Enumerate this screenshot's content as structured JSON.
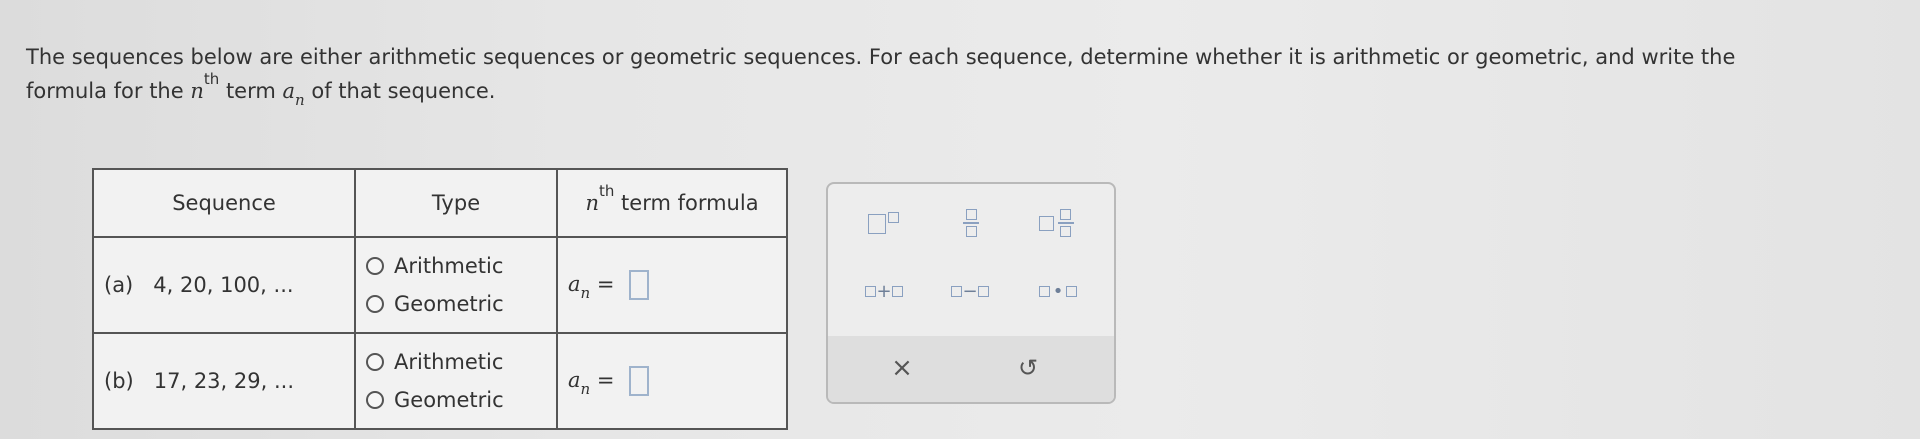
{
  "prompt": {
    "text_1": "The sequences below are either arithmetic sequences or geometric sequences. For each sequence, determine whether it is arithmetic or geometric, and write the",
    "text_2a": "formula for the ",
    "n": "n",
    "th": "th",
    "text_2b": " term ",
    "a": "a",
    "text_2c": " of that sequence."
  },
  "table": {
    "headers": {
      "sequence": "Sequence",
      "type": "Type",
      "formula_rest": " term formula"
    },
    "rows": [
      {
        "label": "(a)",
        "terms": "4, 20, 100, ...",
        "option_arithmetic": "Arithmetic",
        "option_geometric": "Geometric",
        "formula_eq": "="
      },
      {
        "label": "(b)",
        "terms": "17, 23, 29, ...",
        "option_arithmetic": "Arithmetic",
        "option_geometric": "Geometric",
        "formula_eq": "="
      }
    ]
  },
  "palette": {
    "plus": "+",
    "minus": "−",
    "dot": "•",
    "clear": "×",
    "undo": "↺"
  }
}
